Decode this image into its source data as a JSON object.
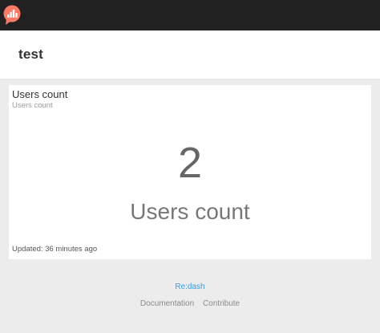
{
  "app": {
    "logo_icon": "redash-logo-icon",
    "logo_color": "#ff7964"
  },
  "dashboard": {
    "title": "test"
  },
  "widget": {
    "title": "Users count",
    "subtitle": "Users count",
    "counter_value": "2",
    "counter_label": "Users count",
    "updated": "Updated: 36 minutes ago"
  },
  "footer": {
    "brand": "Re:dash",
    "brand_color": "#3b9bdb",
    "links": [
      "Documentation",
      "Contribute"
    ]
  }
}
